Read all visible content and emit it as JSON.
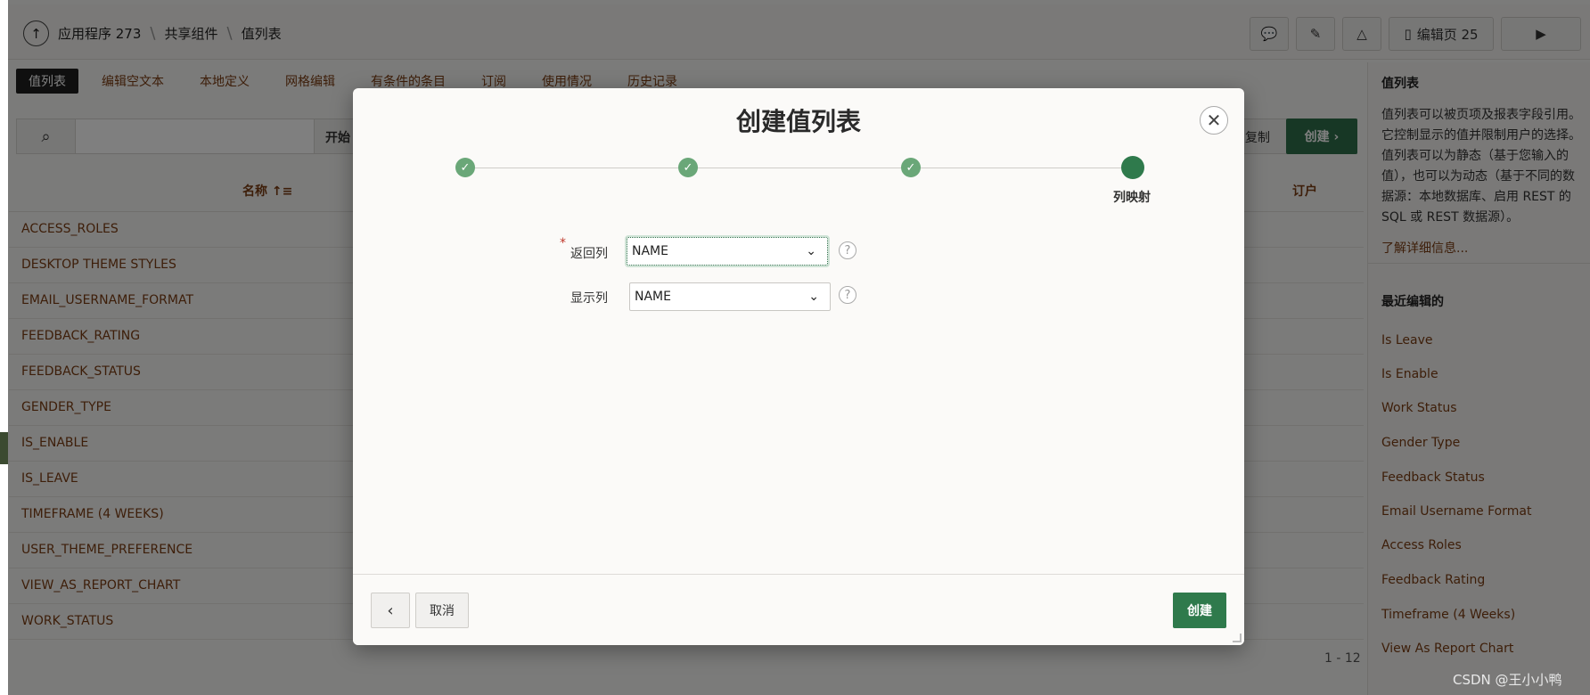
{
  "header": {
    "breadcrumbs": [
      "应用程序 273",
      "共享组件",
      "值列表"
    ],
    "edit_page_label": "编辑页 25"
  },
  "tabs": [
    {
      "label": "值列表",
      "active": true
    },
    {
      "label": "编辑空文本"
    },
    {
      "label": "本地定义"
    },
    {
      "label": "网格编辑"
    },
    {
      "label": "有条件的条目"
    },
    {
      "label": "订阅"
    },
    {
      "label": "使用情况"
    },
    {
      "label": "历史记录"
    }
  ],
  "toolbar": {
    "go_label": "开始",
    "copy_label": "复制",
    "create_label": "创建 ›"
  },
  "report": {
    "columns": {
      "name": "名称 ↑≡",
      "tenant": "订户"
    },
    "rows": [
      "ACCESS_ROLES",
      "DESKTOP THEME STYLES",
      "EMAIL_USERNAME_FORMAT",
      "FEEDBACK_RATING",
      "FEEDBACK_STATUS",
      "GENDER_TYPE",
      "IS_ENABLE",
      "IS_LEAVE",
      "TIMEFRAME (4 WEEKS)",
      "USER_THEME_PREFERENCE",
      "VIEW_AS_REPORT_CHART",
      "WORK_STATUS"
    ],
    "pagination": "1 - 12"
  },
  "sidebar": {
    "title": "值列表",
    "description": "值列表可以被页项及报表字段引用。它控制显示的值并限制用户的选择。值列表可以为静态（基于您输入的值），也可以为动态（基于不同的数据源：本地数据库、启用 REST 的 SQL 或 REST 数据源）。",
    "learn_more": "了解详细信息...",
    "recent_title": "最近编辑的",
    "recent": [
      "Is Leave",
      "Is Enable",
      "Work Status",
      "Gender Type",
      "Feedback Status",
      "Email Username Format",
      "Access Roles",
      "Feedback Rating",
      "Timeframe (4 Weeks)",
      "View As Report Chart"
    ]
  },
  "dialog": {
    "title": "创建值列表",
    "close_symbol": "✕",
    "steps": {
      "done_symbol": "✓",
      "current_label": "列映射"
    },
    "fields": {
      "return_column": {
        "label": "返回列",
        "required_mark": "*",
        "value": "NAME"
      },
      "display_column": {
        "label": "显示列",
        "value": "NAME"
      }
    },
    "help_symbol": "?",
    "footer": {
      "back_symbol": "‹",
      "cancel_label": "取消",
      "create_label": "创建"
    }
  },
  "watermark": "CSDN @王小小鸭",
  "colors": {
    "accent_green": "#2f7a4c",
    "step_done": "#6aa778",
    "link_brown": "#7b3c12"
  }
}
